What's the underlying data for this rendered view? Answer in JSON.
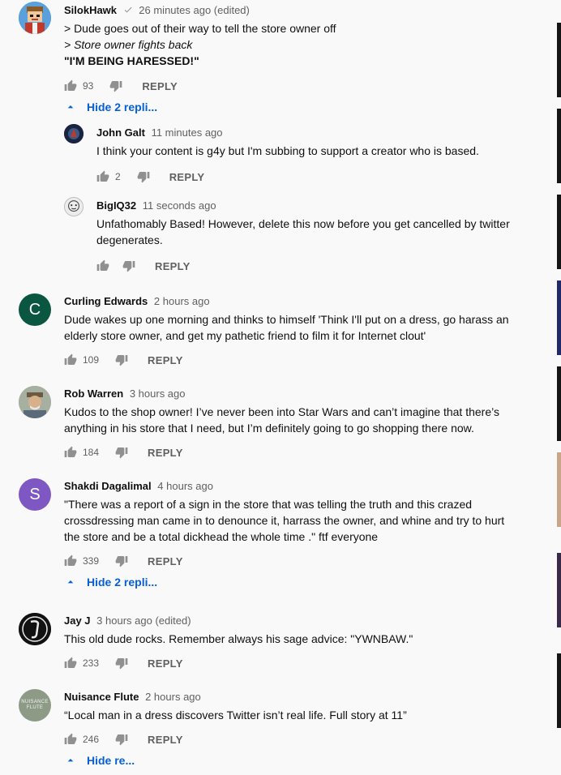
{
  "comments": [
    {
      "author": "SilokHawk",
      "time": "26 minutes ago (edited)",
      "lines": [
        "> Dude goes out of their way to tell the store owner off",
        "> Store owner fights back",
        "\"I'M BEING HARESSED!\""
      ],
      "likes": "93",
      "reply": "REPLY",
      "toggle": "Hide 2 repli...",
      "replies": [
        {
          "author": "John Galt",
          "time": "11 minutes ago",
          "lines": [
            "I think your content is g4y but I'm subbing to support a creator who is based."
          ],
          "likes": "2",
          "reply": "REPLY"
        },
        {
          "author": "BigIQ32",
          "time": "11 seconds ago",
          "lines": [
            "Unfathomably Based! However, delete this now before you get cancelled by twitter",
            "degenerates."
          ],
          "likes": "",
          "reply": "REPLY"
        }
      ]
    },
    {
      "author": "Curling Edwards",
      "time": "2 hours ago",
      "avatar_letter": "C",
      "avatar_color": "#0b5641",
      "lines": [
        "Dude wakes up one morning and thinks to himself 'Think I'll put on a dress, go harass an",
        "elderly store owner, and get my pathetic friend to film it for Internet clout'"
      ],
      "likes": "109",
      "reply": "REPLY"
    },
    {
      "author": "Rob Warren",
      "time": "3 hours ago",
      "lines": [
        "Kudos to the shop owner! I’ve never been into Star Wars and can’t imagine that there’s",
        "anything in his store that I need, but I’m definitely going to go shopping there now."
      ],
      "likes": "184",
      "reply": "REPLY"
    },
    {
      "author": "Shakdi Dagalimal",
      "time": "4 hours ago",
      "avatar_letter": "S",
      "avatar_color": "#7e57c2",
      "lines": [
        "\"There was a report of a sign in the store that was telling the truth and this crazed",
        "crossdressing man came in to denounce it, harrass the owner, and whine and try to hurt",
        "the store and be a total dickhead the whole time .\" ftf everyone"
      ],
      "likes": "339",
      "reply": "REPLY",
      "toggle": "Hide 2 repli..."
    },
    {
      "author": "Jay J",
      "time": "3 hours ago (edited)",
      "lines": [
        "This old dude rocks. Remember always his sage advice: \"YWNBAW.\""
      ],
      "likes": "233",
      "reply": "REPLY"
    },
    {
      "author": "Nuisance Flute",
      "time": "2 hours ago",
      "avatar_text": [
        "NUISANCE",
        "FLUTE"
      ],
      "lines": [
        "“Local man in a dress discovers Twitter isn’t real life. Full story at 11”"
      ],
      "likes": "246",
      "reply": "REPLY",
      "toggle": "Hide re..."
    }
  ]
}
